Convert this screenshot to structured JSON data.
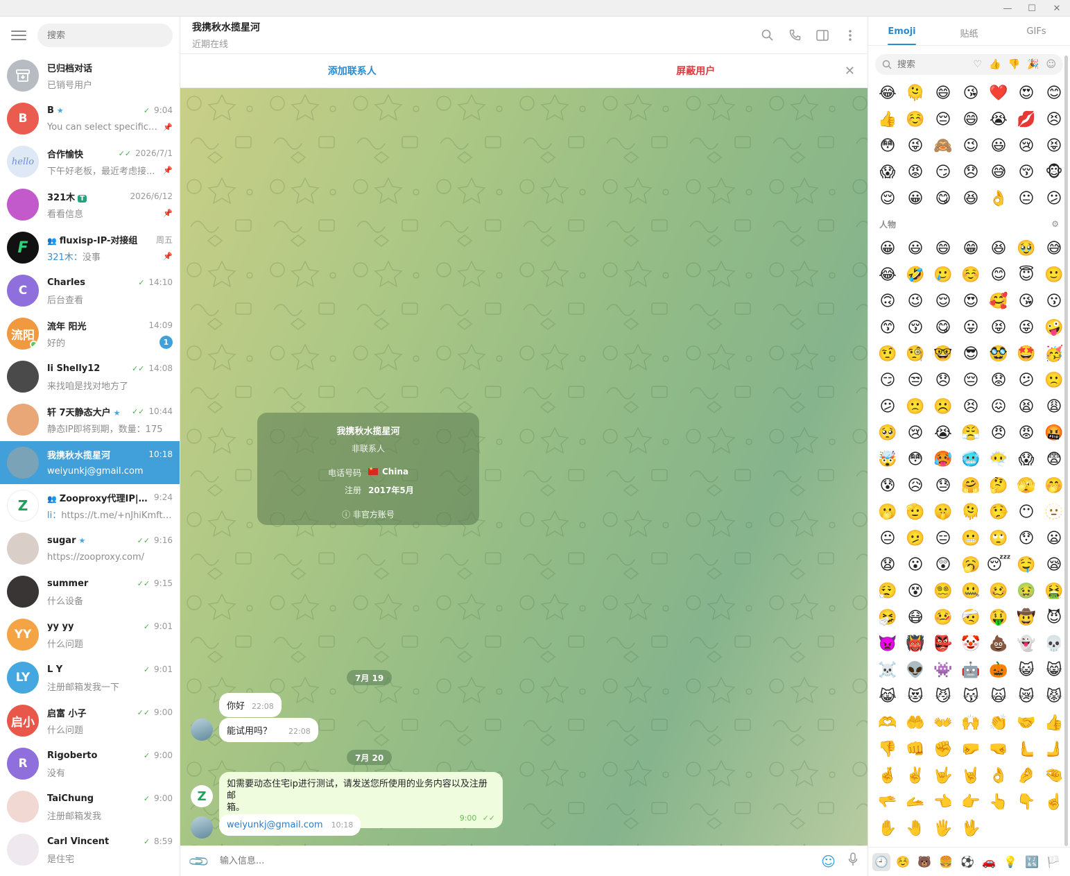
{
  "window": {
    "minimize": "—",
    "maximize": "☐",
    "close": "✕"
  },
  "left": {
    "search_placeholder": "搜索",
    "chats": [
      {
        "name": "已归档对话",
        "preview": "已销号用户",
        "time": "",
        "avatar_text": "",
        "avatar_color": "#b7bcc2",
        "archived": true
      },
      {
        "name": "B",
        "preview": "You can select specific co...",
        "time": "9:04",
        "avatar_text": "B",
        "avatar_color": "#e95c4f",
        "tick": "✓",
        "star": true,
        "pinned": true
      },
      {
        "name": "合作愉快",
        "preview": "下午好老板，最近考虑接...",
        "time": "2026/7/1",
        "avatar_text": "hello",
        "avatar_color": "#dfe9f5",
        "tick": "✓✓",
        "pinned": true
      },
      {
        "name": "321木",
        "preview": "看看信息",
        "time": "2026/6/12",
        "avatar_text": "",
        "avatar_color": "#c25acb",
        "pinned": true,
        "tag": "T"
      },
      {
        "name": "fluxisp-IP-对接组",
        "preview": "没事",
        "sender": "321木：",
        "time": "周五",
        "avatar_text": "F",
        "avatar_color": "#111111",
        "group": true,
        "pinned": true
      },
      {
        "name": "Charles",
        "preview": "后台查看",
        "time": "14:10",
        "avatar_text": "C",
        "avatar_color": "#8e6fdc",
        "tick": "✓"
      },
      {
        "name": "流年 阳光",
        "preview": "好的",
        "time": "14:09",
        "avatar_text": "流阳",
        "avatar_color": "#f0993f",
        "badge": "1",
        "online": true
      },
      {
        "name": "li Shelly12",
        "preview": "来找咱是找对地方了",
        "time": "14:08",
        "avatar_text": "",
        "avatar_color": "#4a4a4a",
        "tick": "✓✓"
      },
      {
        "name": "轩 7天静态大户",
        "preview": "静态IP即将到期，数量：175",
        "time": "10:44",
        "avatar_text": "",
        "avatar_color": "#e9a677",
        "tick": "✓✓",
        "star": true
      },
      {
        "name": "我携秋水揽星河",
        "preview": "weiyunkj@gmail.com",
        "time": "10:18",
        "avatar_text": "",
        "avatar_color": "#7aa3b8",
        "active": true
      },
      {
        "name": "Zooproxy代理IP|动...",
        "preview": "https://t.me/+nJhiKmft_Jxj...",
        "sender": "li：",
        "time": "9:24",
        "avatar_text": "Z",
        "avatar_color": "#ffffff",
        "group": true
      },
      {
        "name": "sugar",
        "preview": "https://zooproxy.com/",
        "time": "9:16",
        "avatar_text": "",
        "avatar_color": "#d9cfc8",
        "tick": "✓✓",
        "star": true
      },
      {
        "name": "summer",
        "preview": "什么设备",
        "time": "9:15",
        "avatar_text": "",
        "avatar_color": "#3a3535",
        "tick": "✓✓"
      },
      {
        "name": "yy yy",
        "preview": "什么问题",
        "time": "9:01",
        "avatar_text": "YY",
        "avatar_color": "#f5a445",
        "tick": "✓"
      },
      {
        "name": "L Y",
        "preview": "注册邮箱发我一下",
        "time": "9:01",
        "avatar_text": "LY",
        "avatar_color": "#45a7e0",
        "tick": "✓"
      },
      {
        "name": "启富 小子",
        "preview": "什么问题",
        "time": "9:00",
        "avatar_text": "启小",
        "avatar_color": "#e9574b",
        "tick": "✓✓"
      },
      {
        "name": "Rigoberto",
        "preview": "没有",
        "time": "9:00",
        "avatar_text": "R",
        "avatar_color": "#8e6fdc",
        "tick": "✓"
      },
      {
        "name": "TaiChung",
        "preview": "注册邮箱发我",
        "time": "9:00",
        "avatar_text": "",
        "avatar_color": "#f1d8d2",
        "tick": "✓"
      },
      {
        "name": "Carl Vincent",
        "preview": "是住宅",
        "time": "8:59",
        "avatar_text": "",
        "avatar_color": "#efe9ef",
        "tick": "✓"
      }
    ]
  },
  "header": {
    "title": "我携秋水揽星河",
    "status": "近期在线"
  },
  "actions": {
    "add_contact": "添加联系人",
    "block_user": "屏蔽用户"
  },
  "info_card": {
    "name": "我携秋水揽星河",
    "subtitle": "非联系人",
    "phone_label": "电话号码",
    "phone_value": "China",
    "reg_label": "注册",
    "reg_value": "2017年5月",
    "footer": "非官方账号"
  },
  "messages": {
    "date1": "7月 19",
    "m1_text": "你好",
    "m1_time": "22:08",
    "m2_text": "能试用吗？",
    "m2_time": "22:08",
    "date2": "7月 20",
    "m3_text_line1": "如需要动态住宅ip进行测试，请发送您所使用的业务内容以及注册邮",
    "m3_text_line2": "箱。",
    "m3_time": "9:00",
    "m4_text": "weiyunkj@gmail.com",
    "m4_time": "10:18"
  },
  "composer": {
    "placeholder": "输入信息..."
  },
  "emoji_panel": {
    "tabs": [
      "Emoji",
      "贴纸",
      "GIFs"
    ],
    "search_placeholder": "搜索",
    "recent": [
      "😂",
      "🫠",
      "😄",
      "😘",
      "❤️",
      "😍",
      "😊",
      "👍",
      "☺️",
      "😔",
      "😄",
      "😭",
      "💋",
      "😣",
      "😳",
      "😜",
      "🙈",
      "😉",
      "😃",
      "😢",
      "😝",
      "😱",
      "😡",
      "😏",
      "😞",
      "😅",
      "😚",
      "🐵",
      "😌",
      "😀",
      "😋",
      "😆",
      "👌",
      "😐",
      "😕"
    ],
    "section_people": "人物",
    "people": [
      "😀",
      "😃",
      "😄",
      "😁",
      "😆",
      "🥹",
      "😅",
      "😂",
      "🤣",
      "🥲",
      "☺️",
      "😊",
      "😇",
      "🙂",
      "🙃",
      "😉",
      "😌",
      "😍",
      "🥰",
      "😘",
      "😗",
      "😙",
      "😚",
      "😋",
      "😛",
      "😝",
      "😜",
      "🤪",
      "🤨",
      "🧐",
      "🤓",
      "😎",
      "🥸",
      "🤩",
      "🥳",
      "😏",
      "😒",
      "😞",
      "😔",
      "😟",
      "😕",
      "🙁",
      "😕",
      "🙁",
      "☹️",
      "😣",
      "😖",
      "😫",
      "😩",
      "🥺",
      "😢",
      "😭",
      "😤",
      "😠",
      "😡",
      "🤬",
      "🤯",
      "😳",
      "🥵",
      "🥶",
      "😶‍🌫️",
      "😱",
      "😨",
      "😰",
      "😥",
      "😓",
      "🤗",
      "🤔",
      "🫣",
      "🤭",
      "🫢",
      "🫡",
      "🤫",
      "🫠",
      "🤥",
      "😶",
      "🫥",
      "😐",
      "🫤",
      "😑",
      "😬",
      "🙄",
      "😯",
      "😦",
      "😧",
      "😮",
      "😲",
      "🥱",
      "😴",
      "🤤",
      "😪",
      "😮‍💨",
      "😵",
      "😵‍💫",
      "🤐",
      "🥴",
      "🤢",
      "🤮",
      "🤧",
      "😷",
      "🤒",
      "🤕",
      "🤑",
      "🤠",
      "😈",
      "👿",
      "👹",
      "👺",
      "🤡",
      "💩",
      "👻",
      "💀",
      "☠️",
      "👽",
      "👾",
      "🤖",
      "🎃",
      "😺",
      "😸",
      "😹",
      "😻",
      "😼",
      "😽",
      "🙀",
      "😿",
      "😾",
      "🫶",
      "🤲",
      "👐",
      "🙌",
      "👏",
      "🤝",
      "👍",
      "👎",
      "👊",
      "✊",
      "🤛",
      "🤜",
      "🫷",
      "🫸",
      "🤞",
      "✌️",
      "🤟",
      "🤘",
      "👌",
      "🤌",
      "🤏",
      "🫳",
      "🫴",
      "👈",
      "👉",
      "👆",
      "👇",
      "☝️",
      "✋",
      "🤚",
      "🖐️",
      "🖖"
    ],
    "categories": [
      "🕘",
      "☺️",
      "🐻",
      "🍔",
      "⚽",
      "🚗",
      "💡",
      "🔣",
      "🏳️"
    ]
  }
}
